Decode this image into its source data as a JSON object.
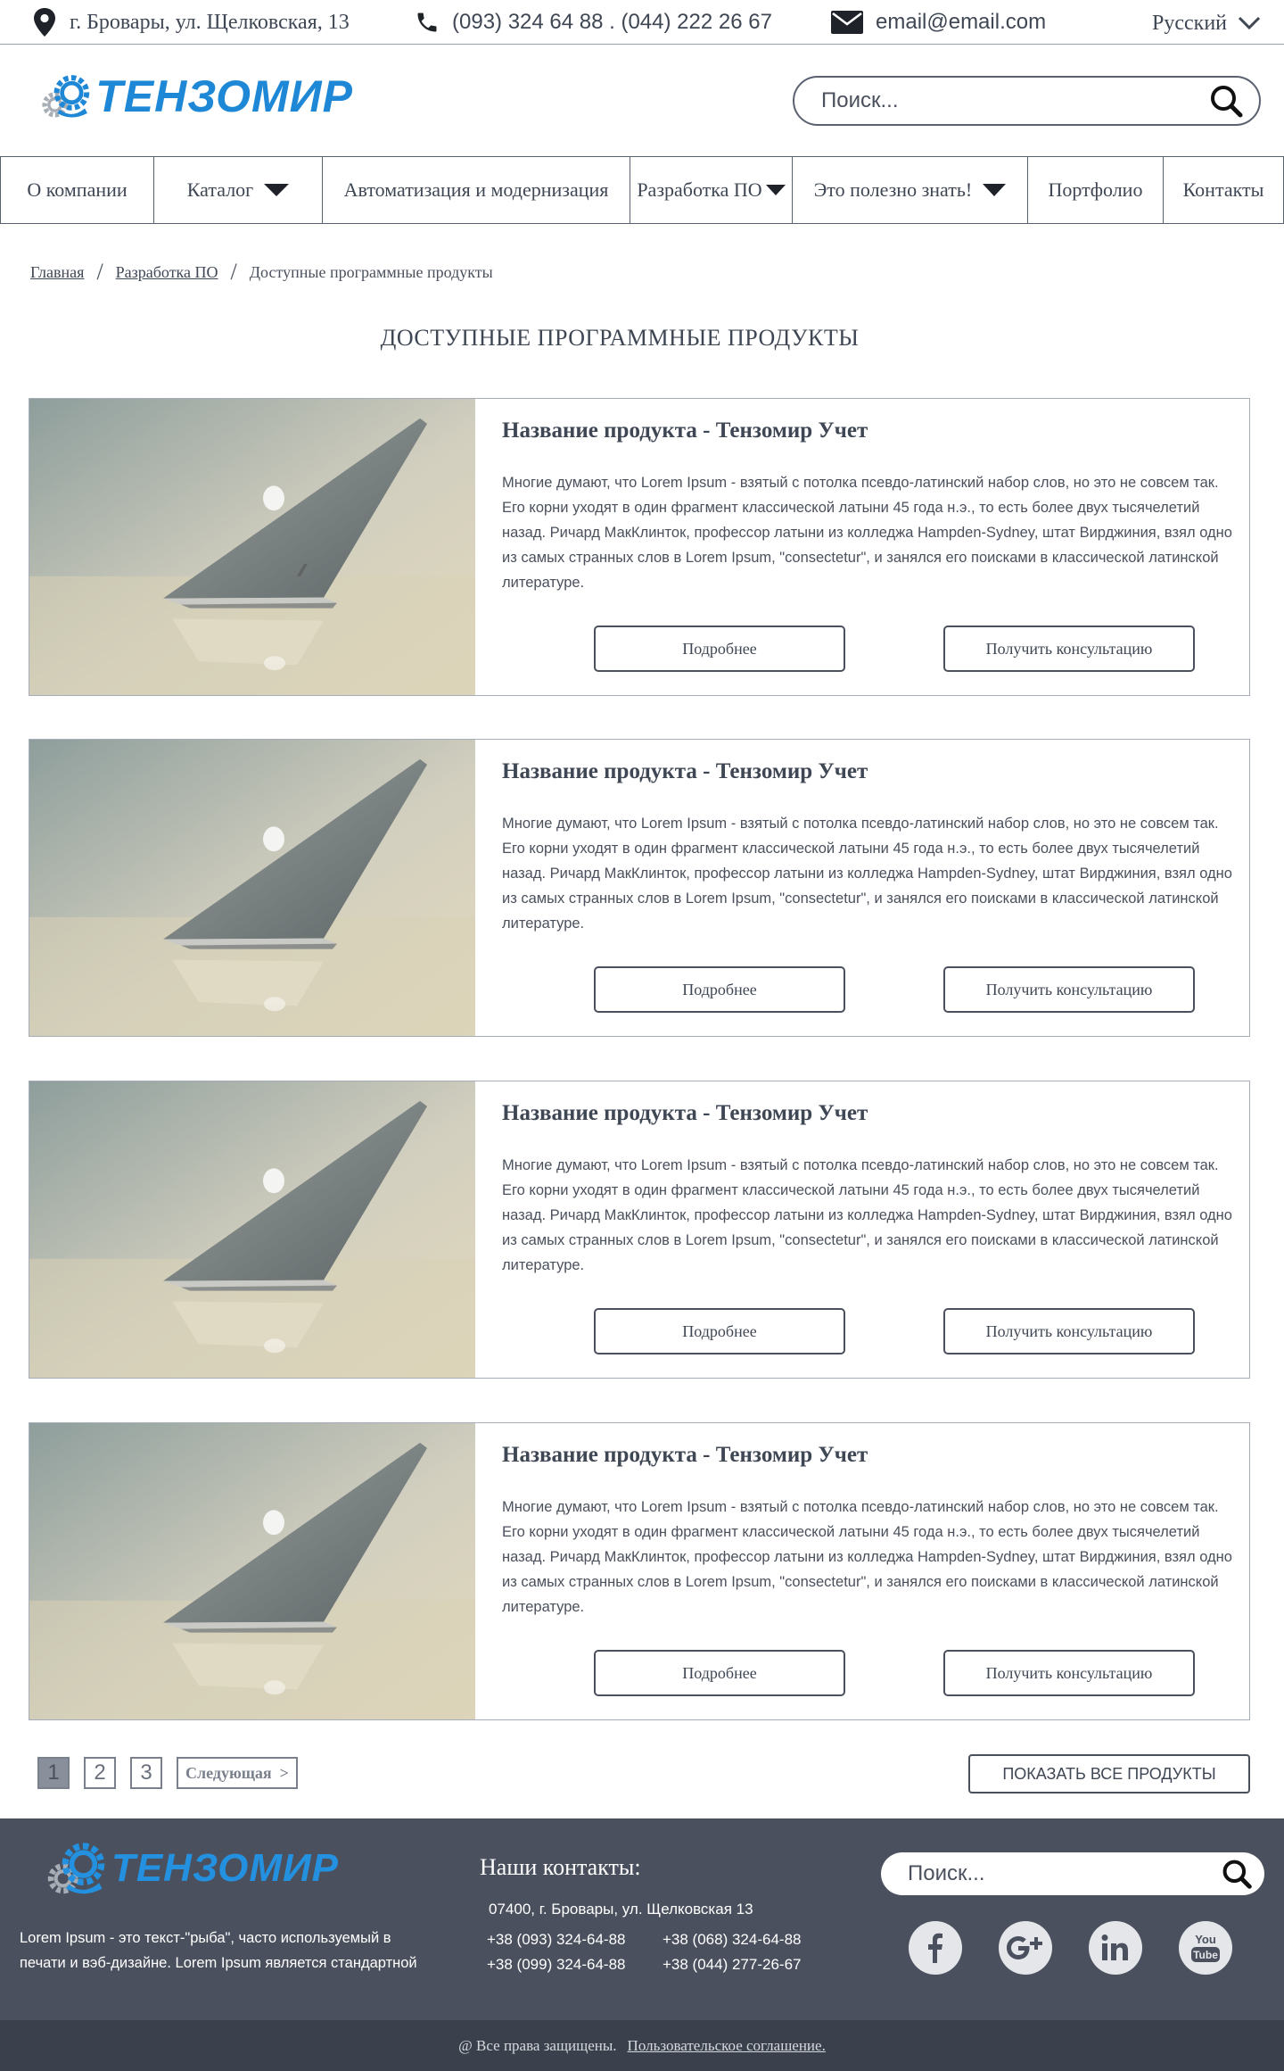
{
  "topbar": {
    "address": "г. Бровары, ул. Щелковская, 13",
    "phones": "(093) 324 64 88 . (044) 222 26 67",
    "email": "email@email.com",
    "language": "Русский"
  },
  "header": {
    "logo_text": "ТЕНЗОМИР",
    "search_placeholder": "Поиск..."
  },
  "nav": {
    "items": [
      {
        "label": "О компании"
      },
      {
        "label": "Каталог"
      },
      {
        "label": "Автоматизация и модернизация"
      },
      {
        "label": "Разработка ПО"
      },
      {
        "label": "Это полезно знать!"
      },
      {
        "label": "Портфолио"
      },
      {
        "label": "Контакты"
      }
    ]
  },
  "breadcrumb": {
    "home": "Главная",
    "section": "Разработка ПО",
    "current": "Доступные программные продукты"
  },
  "page_title": "ДОСТУПНЫЕ ПРОГРАММНЫЕ ПРОДУКТЫ",
  "products": [
    {
      "title": "Название продукта - Тензомир Учет",
      "description": "Многие думают, что Lorem Ipsum - взятый с потолка псевдо-латинский набор слов, но это не совсем так. Его корни уходят в один фрагмент классической латыни 45 года н.э., то есть более двух тысячелетий назад. Ричард МакКлинток, профессор латыни из колледжа Hampden-Sydney, штат Вирджиния, взял одно из самых странных слов в Lorem Ipsum, \"consectetur\", и занялся его поисками в классической латинской литературе.",
      "more_label": "Подробнее",
      "consult_label": "Получить консультацию"
    },
    {
      "title": "Название продукта - Тензомир Учет",
      "description": "Многие думают, что Lorem Ipsum - взятый с потолка псевдо-латинский набор слов, но это не совсем так. Его корни уходят в один фрагмент классической латыни 45 года н.э., то есть более двух тысячелетий назад. Ричард МакКлинток, профессор латыни из колледжа Hampden-Sydney, штат Вирджиния, взял одно из самых странных слов в Lorem Ipsum, \"consectetur\", и занялся его поисками в классической латинской литературе.",
      "more_label": "Подробнее",
      "consult_label": "Получить консультацию"
    },
    {
      "title": "Название продукта - Тензомир Учет",
      "description": "Многие думают, что Lorem Ipsum - взятый с потолка псевдо-латинский набор слов, но это не совсем так. Его корни уходят в один фрагмент классической латыни 45 года н.э., то есть более двух тысячелетий назад. Ричард МакКлинток, профессор латыни из колледжа Hampden-Sydney, штат Вирджиния, взял одно из самых странных слов в Lorem Ipsum, \"consectetur\", и занялся его поисками в классической латинской литературе.",
      "more_label": "Подробнее",
      "consult_label": "Получить консультацию"
    },
    {
      "title": "Название продукта - Тензомир Учет",
      "description": "Многие думают, что Lorem Ipsum - взятый с потолка псевдо-латинский набор слов, но это не совсем так. Его корни уходят в один фрагмент классической латыни 45 года н.э., то есть более двух тысячелетий назад. Ричард МакКлинток, профессор латыни из колледжа Hampden-Sydney, штат Вирджиния, взял одно из самых странных слов в Lorem Ipsum, \"consectetur\", и занялся его поисками в классической латинской литературе.",
      "more_label": "Подробнее",
      "consult_label": "Получить консультацию"
    }
  ],
  "pagination": {
    "pages": [
      "1",
      "2",
      "3"
    ],
    "current": "1",
    "next_label": "Следующая  >",
    "show_all_label": "ПОКАЗАТЬ ВСЕ ПРОДУКТЫ"
  },
  "footer": {
    "logo_text": "ТЕНЗОМИР",
    "about": "Lorem Ipsum - это текст-\"рыба\", часто используемый в печати и вэб-дизайне. Lorem Ipsum является стандартной",
    "contacts_title": "Наши контакты:",
    "address": "07400, г. Бровары, ул. Щелковская 13",
    "phones": [
      "+38 (093) 324-64-88",
      "+38 (068) 324-64-88",
      "+38 (099) 324-64-88",
      "+38 (044) 277-26-67"
    ],
    "search_placeholder": "Поиск...",
    "social": [
      "facebook-icon",
      "google-plus-icon",
      "linkedin-icon",
      "youtube-icon"
    ],
    "youtube_logo_text": [
      "You",
      "Tube"
    ],
    "copyright": "@ Все права защищены.",
    "agreement_link": "Пользовательское соглашение."
  },
  "colors": {
    "brand_blue": "#1e88d6",
    "text": "#3f4754",
    "footer_bg": "#4a505d",
    "bottombar_bg": "#3b414c"
  }
}
